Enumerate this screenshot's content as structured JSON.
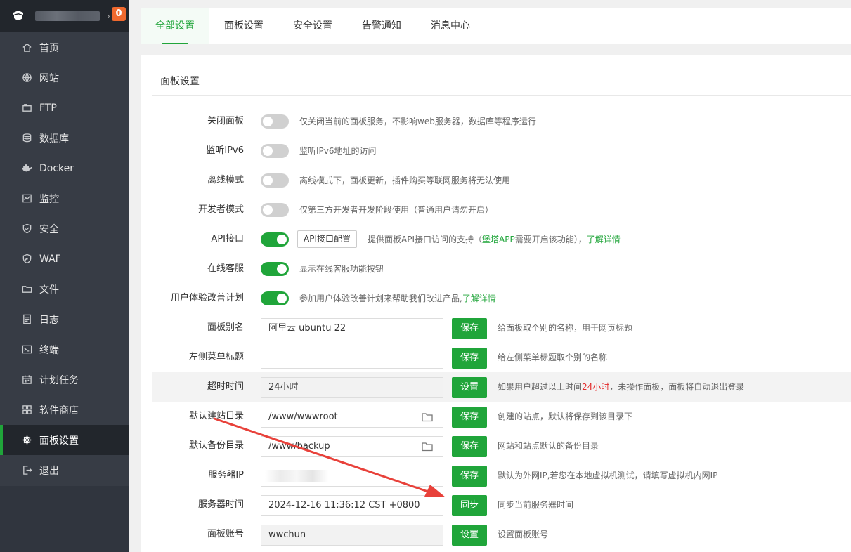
{
  "sidebar": {
    "badge": "0",
    "username_blurred": "",
    "items": [
      {
        "label": "首页",
        "icon": "home-icon"
      },
      {
        "label": "网站",
        "icon": "globe-icon"
      },
      {
        "label": "FTP",
        "icon": "ftp-icon"
      },
      {
        "label": "数据库",
        "icon": "database-icon"
      },
      {
        "label": "Docker",
        "icon": "docker-icon"
      },
      {
        "label": "监控",
        "icon": "monitor-icon"
      },
      {
        "label": "安全",
        "icon": "shield-icon"
      },
      {
        "label": "WAF",
        "icon": "waf-icon"
      },
      {
        "label": "文件",
        "icon": "folder-icon"
      },
      {
        "label": "日志",
        "icon": "log-icon"
      },
      {
        "label": "终端",
        "icon": "terminal-icon"
      },
      {
        "label": "计划任务",
        "icon": "calendar-icon"
      },
      {
        "label": "软件商店",
        "icon": "grid-icon"
      },
      {
        "label": "面板设置",
        "icon": "gear-icon",
        "active": true
      },
      {
        "label": "退出",
        "icon": "logout-icon"
      }
    ]
  },
  "tabs": [
    "全部设置",
    "面板设置",
    "安全设置",
    "告警通知",
    "消息中心"
  ],
  "section_title": "面板设置",
  "settings": {
    "close_panel": {
      "label": "关闭面板",
      "on": false,
      "desc": "仅关闭当前的面板服务，不影响web服务器，数据库等程序运行"
    },
    "ipv6": {
      "label": "监听IPv6",
      "on": false,
      "desc": "监听IPv6地址的访问"
    },
    "offline": {
      "label": "离线模式",
      "on": false,
      "desc": "离线模式下，面板更新，插件购买等联网服务将无法使用"
    },
    "developer": {
      "label": "开发者模式",
      "on": false,
      "desc": "仅第三方开发者开发阶段使用（普通用户请勿开启）"
    },
    "api": {
      "label": "API接口",
      "on": true,
      "button": "API接口配置",
      "desc_a": "提供面板API接口访问的支持（",
      "desc_b": "堡塔APP",
      "desc_c": "需要开启该功能），",
      "desc_link": "了解详情"
    },
    "online_service": {
      "label": "在线客服",
      "on": true,
      "desc": "显示在线客服功能按钮"
    },
    "ux_plan": {
      "label": "用户体验改善计划",
      "on": true,
      "desc": "参加用户体验改善计划来帮助我们改进产品,",
      "desc_link": "了解详情"
    },
    "panel_alias": {
      "label": "面板别名",
      "value": "阿里云 ubuntu 22",
      "button": "保存",
      "desc": "给面板取个别的名称，用于网页标题"
    },
    "menu_title": {
      "label": "左侧菜单标题",
      "value": "",
      "button": "保存",
      "desc": "给左侧菜单标题取个别的名称"
    },
    "timeout": {
      "label": "超时时间",
      "value": "24小时",
      "button": "设置",
      "desc_a": "如果用户超过以上时间",
      "desc_red": "24小时",
      "desc_b": "，未操作面板，面板将自动退出登录"
    },
    "site_dir": {
      "label": "默认建站目录",
      "value": "/www/wwwroot",
      "button": "保存",
      "desc": "创建的站点，默认将保存到该目录下"
    },
    "backup_dir": {
      "label": "默认备份目录",
      "value": "/www/backup",
      "button": "保存",
      "desc": "网站和站点默认的备份目录"
    },
    "server_ip": {
      "label": "服务器IP",
      "value": "",
      "button": "保存",
      "desc": "默认为外网IP,若您在本地虚拟机测试，请填写虚拟机内网IP"
    },
    "server_time": {
      "label": "服务器时间",
      "value": "2024-12-16 11:36:12 CST +0800",
      "button": "同步",
      "desc": "同步当前服务器时间"
    },
    "account": {
      "label": "面板账号",
      "value": "wwchun",
      "button": "设置",
      "desc": "设置面板账号"
    }
  },
  "colors": {
    "accent": "#20a53a",
    "sidebar": "#373c45",
    "badge": "#f0692e",
    "annotation_arrow": "#e8413a"
  }
}
